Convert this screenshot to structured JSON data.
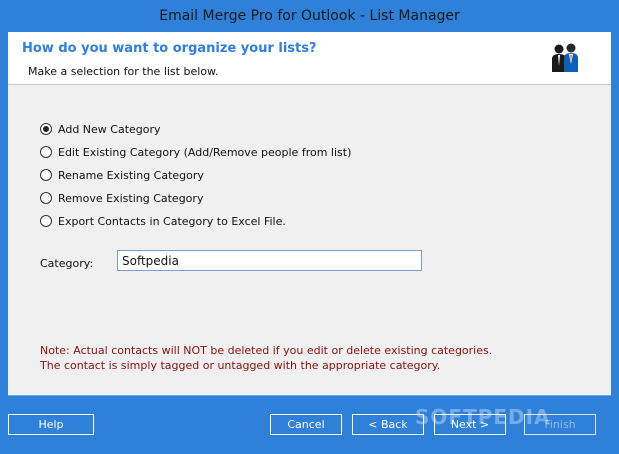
{
  "window": {
    "title": "Email Merge Pro for Outlook - List Manager"
  },
  "header": {
    "question": "How do you want to organize your lists?",
    "subtitle": "Make a selection for the list below.",
    "icon": "people-icon"
  },
  "options": [
    {
      "label": "Add New Category",
      "checked": true
    },
    {
      "label": "Edit Existing Category (Add/Remove people from list)",
      "checked": false
    },
    {
      "label": "Rename Existing Category",
      "checked": false
    },
    {
      "label": "Remove Existing Category",
      "checked": false
    },
    {
      "label": "Export Contacts in Category to Excel File.",
      "checked": false
    }
  ],
  "category": {
    "label": "Category:",
    "value": "Softpedia"
  },
  "note": {
    "line1": "Note: Actual contacts will NOT be deleted if you edit or delete existing categories.",
    "line2": "The contact is simply tagged or untagged with the appropriate category."
  },
  "buttons": {
    "help": "Help",
    "cancel": "Cancel",
    "back": "< Back",
    "next": "Next >",
    "finish": "Finish"
  },
  "watermark": "SOFTPEDIA"
}
